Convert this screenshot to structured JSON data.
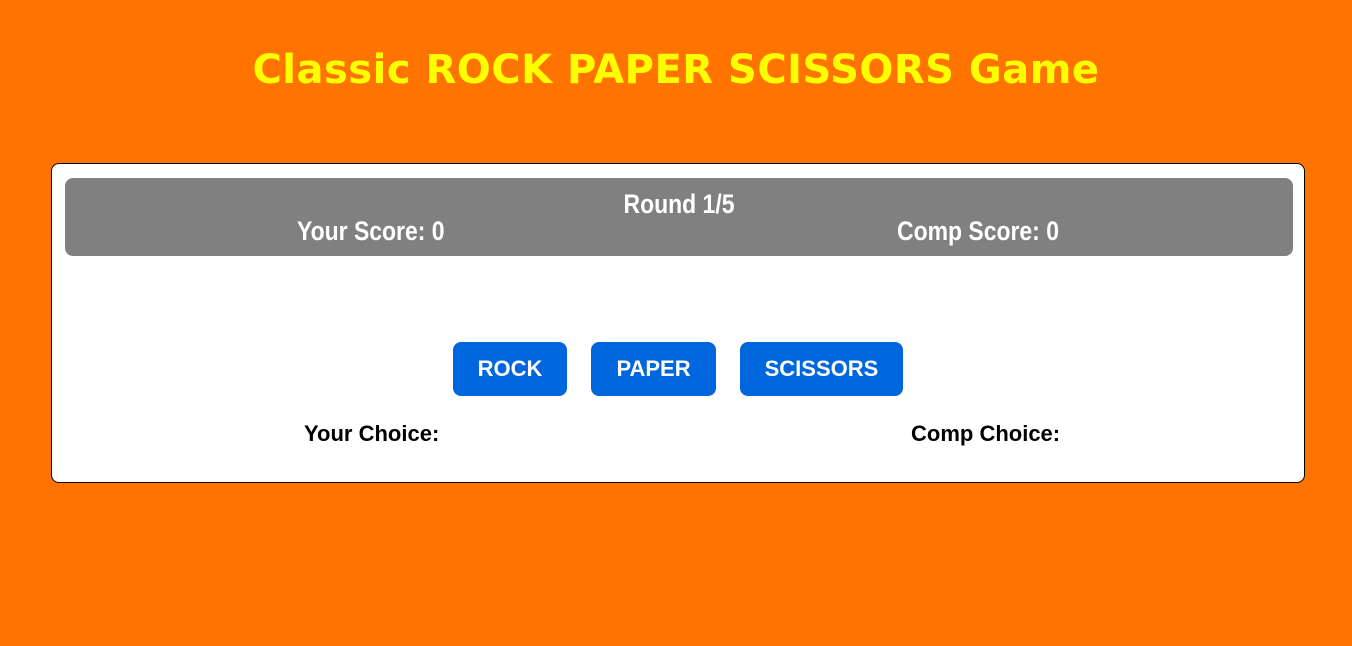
{
  "header": {
    "title": "Classic ROCK PAPER SCISSORS Game"
  },
  "scoreboard": {
    "round": "Round 1/5",
    "your_score": "Your Score: 0",
    "comp_score": "Comp Score: 0"
  },
  "choices": [
    {
      "label": "ROCK"
    },
    {
      "label": "PAPER"
    },
    {
      "label": "SCISSORS"
    }
  ],
  "selection": {
    "your_choice": "Your Choice:",
    "comp_choice": "Comp Choice:"
  },
  "colors": {
    "background": "#ff7300",
    "title": "#ffff00",
    "card": "#ffffff",
    "scoreboard": "#808080",
    "button": "#0066dd"
  }
}
